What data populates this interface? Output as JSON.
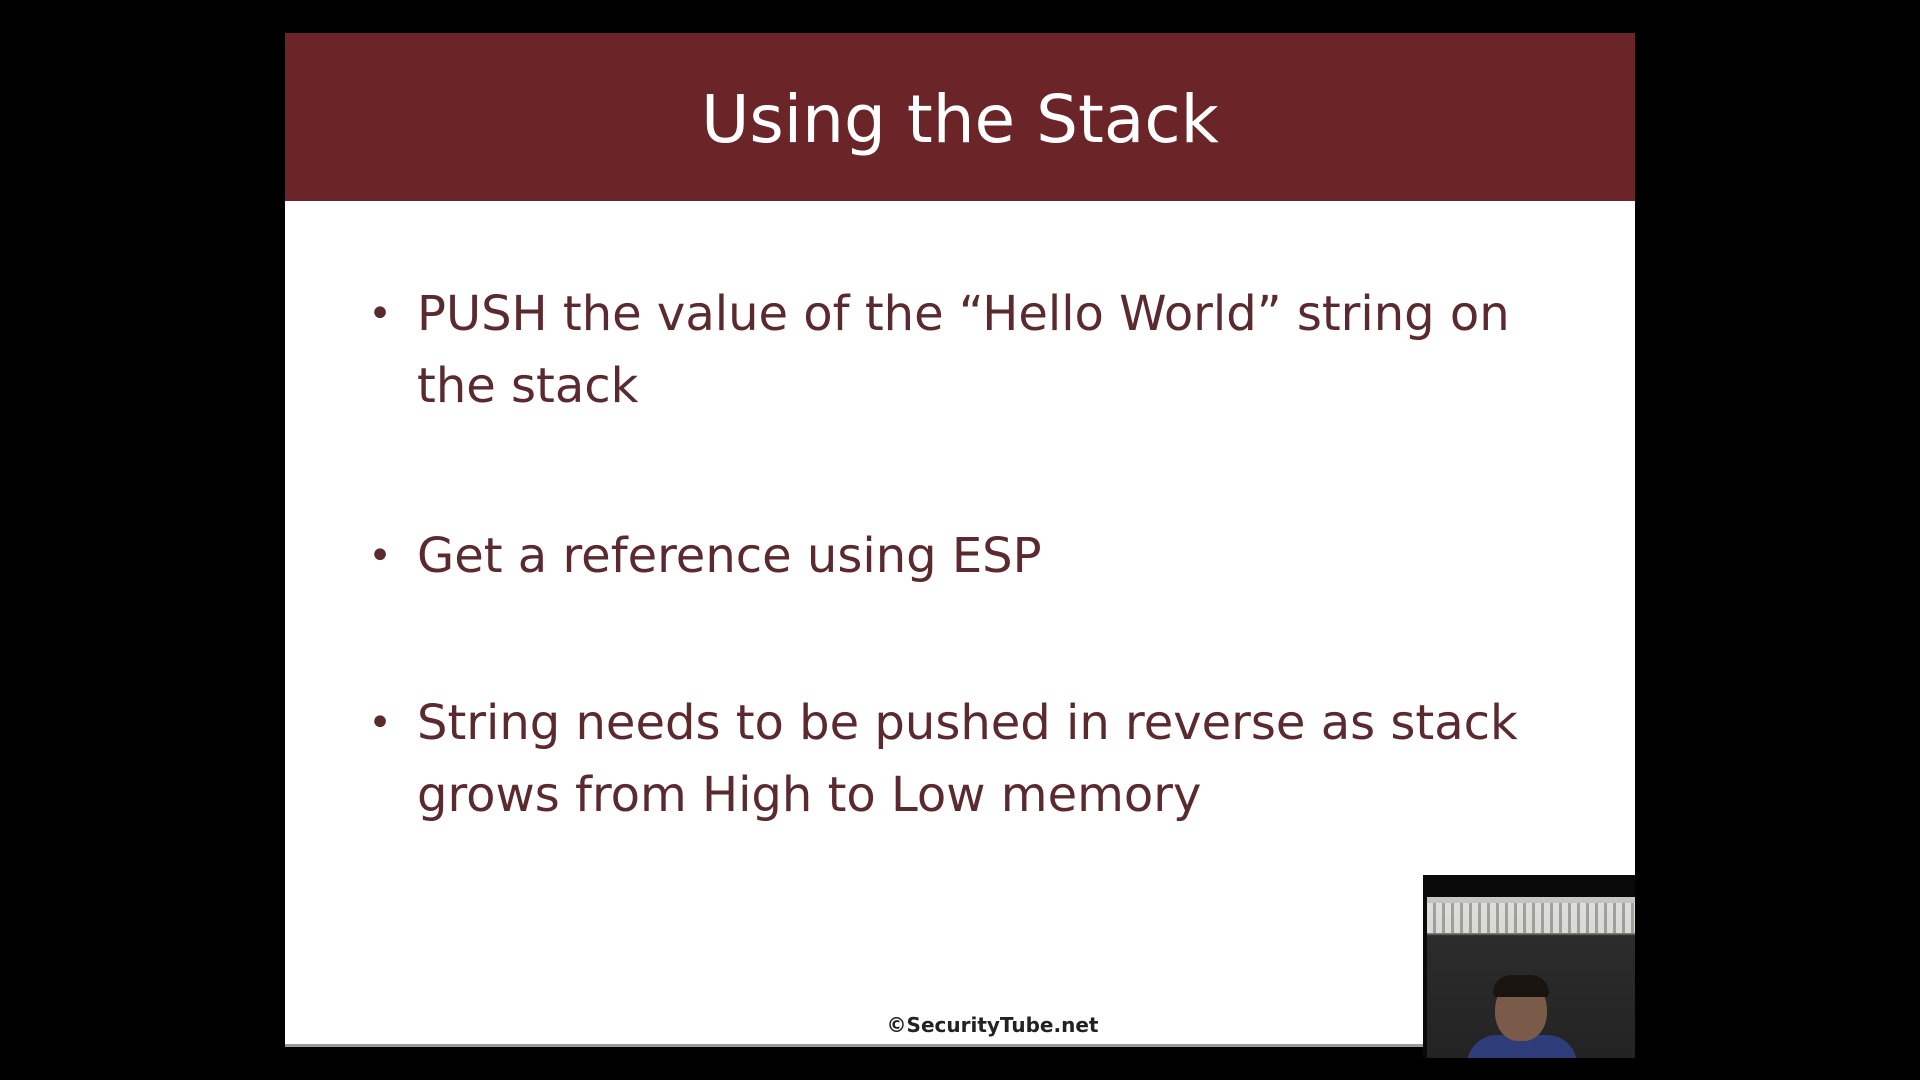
{
  "slide": {
    "title": "Using the Stack",
    "bullets": [
      "PUSH the value of the “Hello World” string on the stack",
      "Get a reference using ESP",
      "String needs to be pushed in reverse as stack grows from High to Low memory"
    ],
    "bullet_glyph": "•",
    "footer": "©SecurityTube.net"
  },
  "colors": {
    "title_bar": "#6b2428",
    "title_text": "#ffffff",
    "body_text": "#5a2a2e",
    "letterbox": "#000000"
  },
  "webcam": {
    "icon": "presenter-webcam-thumbnail"
  }
}
